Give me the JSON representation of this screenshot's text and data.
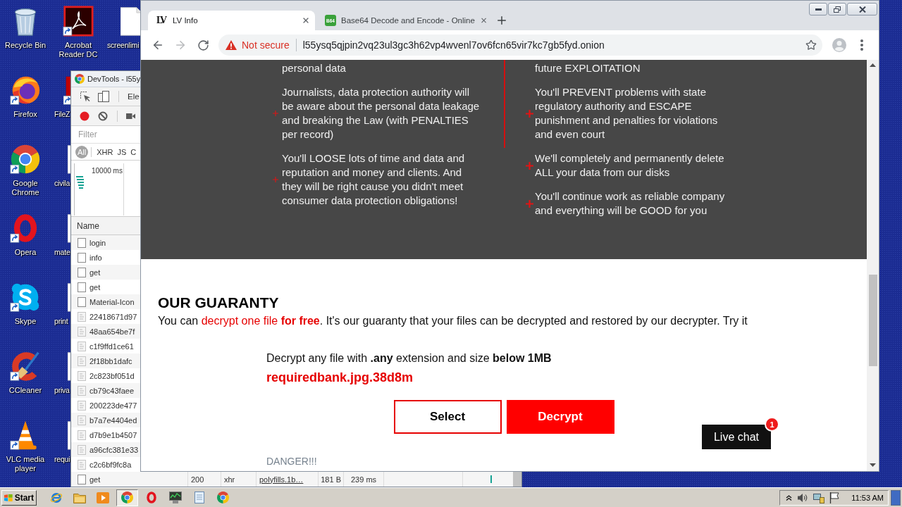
{
  "desktop": {
    "icon_columns": [
      [
        {
          "label": "Recycle Bin",
          "kind": "recycle_bin"
        },
        {
          "label": "Firefox",
          "kind": "firefox"
        },
        {
          "label": "Google Chrome",
          "kind": "chrome"
        },
        {
          "label": "Opera",
          "kind": "opera"
        },
        {
          "label": "Skype",
          "kind": "skype"
        },
        {
          "label": "CCleaner",
          "kind": "ccleaner"
        },
        {
          "label": "VLC media player",
          "kind": "vlc"
        }
      ],
      [
        {
          "label": "Acrobat Reader DC",
          "kind": "acrobat"
        },
        {
          "label": "FileZ",
          "kind": "filezilla"
        },
        {
          "label": "civila",
          "kind": "document"
        },
        {
          "label": "mate",
          "kind": "document"
        },
        {
          "label": "print",
          "kind": "document"
        },
        {
          "label": "priva",
          "kind": "document"
        },
        {
          "label": "requi",
          "kind": "document"
        }
      ],
      [
        {
          "label": "screenlimi",
          "kind": "document"
        }
      ]
    ]
  },
  "devtools": {
    "title": "DevTools - l55y",
    "panel_tab": "Ele",
    "recording": true,
    "filter": {
      "placeholder": "Filter"
    },
    "type_filters": [
      {
        "label": "All",
        "selected": true
      },
      {
        "label": "XHR",
        "selected": false
      },
      {
        "label": "JS",
        "selected": false
      },
      {
        "label": "C",
        "selected": false
      }
    ],
    "overview_label": "10000 ms",
    "name_header": "Name",
    "requests": [
      {
        "name": "login",
        "kind": "document"
      },
      {
        "name": "info",
        "kind": "document"
      },
      {
        "name": "get",
        "kind": "document"
      },
      {
        "name": "get",
        "kind": "document"
      },
      {
        "name": "Material-Icon",
        "kind": "document"
      },
      {
        "name": "22418671d97",
        "kind": "image"
      },
      {
        "name": "48aa654be7f",
        "kind": "image"
      },
      {
        "name": "c1f9ffd1ce61",
        "kind": "image"
      },
      {
        "name": "2f18bb1dafc",
        "kind": "image"
      },
      {
        "name": "2c823bf051d",
        "kind": "image"
      },
      {
        "name": "cb79c43faee",
        "kind": "image"
      },
      {
        "name": "200223de477",
        "kind": "image"
      },
      {
        "name": "b7a7e4404ed",
        "kind": "image"
      },
      {
        "name": "d7b9e1b4507",
        "kind": "image"
      },
      {
        "name": "a96cfc381e33",
        "kind": "image"
      },
      {
        "name": "c2c6bf9fc8a",
        "kind": "image"
      },
      {
        "name": "get",
        "kind": "document",
        "status": "200",
        "type": "xhr",
        "initiator": "polyfills.1b…",
        "size": "181 B",
        "time": "239 ms"
      }
    ]
  },
  "browser": {
    "tabs": [
      {
        "title": "LV Info",
        "icon": {
          "kind": "monogram",
          "text": "LV"
        },
        "selected": true
      },
      {
        "title": "Base64 Decode and Encode - Online",
        "icon": {
          "kind": "badge",
          "text": "B64"
        },
        "selected": false
      }
    ],
    "forward_disabled": true,
    "security_label": "Not secure",
    "url": "l55ysq5qjpin2vq23ul3gc3h62vp4wvenl7ov6fcn65vir7kc7gb5fyd.onion",
    "page": {
      "outcomes": {
        "left": [
          {
            "kind": "continued",
            "text": "personal data"
          },
          {
            "kind": "point",
            "text": "Journalists, data protection authority will be aware about the personal data leakage and breaking the Law (with PENALTIES per record)"
          },
          {
            "kind": "point",
            "text": "You'll LOOSE lots of time and data and reputation and money and clients. And they will be right cause you didn't meet consumer data protection obligations!"
          }
        ],
        "right": [
          {
            "kind": "continued",
            "text": "future EXPLOITATION"
          },
          {
            "kind": "point",
            "text": "You'll PREVENT problems with state regulatory authority and ESCAPE punishment and penalties for violations and even court"
          },
          {
            "kind": "point",
            "text": "We'll completely and permanently delete ALL your data from our disks"
          },
          {
            "kind": "point",
            "text": "You'll continue work as reliable company and everything will be GOOD for you"
          }
        ]
      },
      "guaranty": {
        "heading": "OUR GUARANTY",
        "intro": [
          {
            "kind": "plain",
            "text": "You can "
          },
          {
            "kind": "accent",
            "text": "decrypt one file **for free**"
          },
          {
            "kind": "plain",
            "text": ". It's our guaranty that your files can be decrypted and restored by our decrypter. Try it"
          }
        ],
        "instruction": "Decrypt any file with **.any** extension and size **below 1MB**",
        "file_name": "requiredbank.jpg.38d8m",
        "buttons": [
          {
            "label": "Select",
            "kind": "outline"
          },
          {
            "label": "Decrypt",
            "kind": "filled"
          }
        ],
        "warning": "DANGER!!!"
      },
      "live_chat": {
        "label": "Live chat",
        "badge": "1"
      }
    }
  },
  "taskbar": {
    "start_label": "Start",
    "quick_launch": [
      {
        "kind": "ie"
      },
      {
        "kind": "folder"
      },
      {
        "kind": "media_player"
      }
    ],
    "tasks": [
      {
        "kind": "chrome",
        "selected": true
      },
      {
        "kind": "opera",
        "selected": false
      },
      {
        "kind": "monitor",
        "selected": false
      },
      {
        "kind": "notepad",
        "selected": false
      },
      {
        "kind": "chrome",
        "selected": false
      }
    ],
    "clock": "11:53 AM"
  }
}
